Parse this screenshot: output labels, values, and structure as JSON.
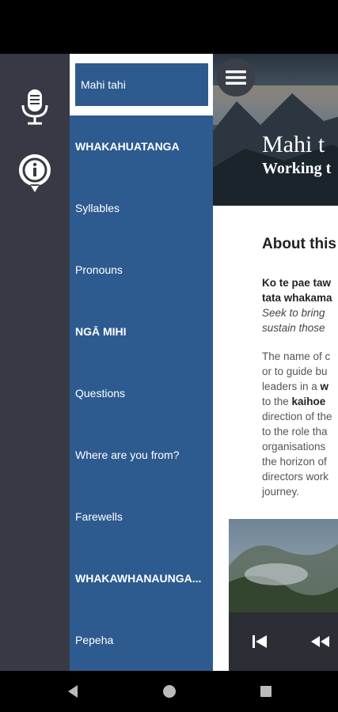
{
  "rail": {
    "icons": [
      "microphone-icon",
      "info-icon"
    ]
  },
  "drawer": {
    "items": [
      {
        "label": "Mahi tahi",
        "type": "item",
        "active": true
      },
      {
        "label": "WHAKAHUATANGA",
        "type": "section"
      },
      {
        "label": "Syllables",
        "type": "item"
      },
      {
        "label": "Pronouns",
        "type": "item"
      },
      {
        "label": "NGĀ MIHI",
        "type": "section"
      },
      {
        "label": "Questions",
        "type": "item"
      },
      {
        "label": "Where are you from?",
        "type": "item"
      },
      {
        "label": "Farewells",
        "type": "item"
      },
      {
        "label": "WHAKAWHANAUNGA...",
        "type": "section"
      },
      {
        "label": "Pepeha",
        "type": "item"
      }
    ]
  },
  "hero": {
    "title": "Mahi t",
    "subtitle": "Working t"
  },
  "about": {
    "heading": "About this",
    "bold_lines": [
      "Ko te pae taw",
      "tata whakama"
    ],
    "italic_lines": [
      "Seek to bring",
      "sustain those"
    ],
    "body_lines": [
      {
        "segments": [
          {
            "t": "The name of c"
          }
        ]
      },
      {
        "segments": [
          {
            "t": "or to guide bu"
          }
        ]
      },
      {
        "segments": [
          {
            "t": "leaders in a "
          },
          {
            "t": "w",
            "b": true
          }
        ]
      },
      {
        "segments": [
          {
            "t": "to the "
          },
          {
            "t": "kaihoe",
            "b": true
          }
        ]
      },
      {
        "segments": [
          {
            "t": "direction of the"
          }
        ]
      },
      {
        "segments": [
          {
            "t": "to the role tha"
          }
        ]
      },
      {
        "segments": [
          {
            "t": "organisations"
          }
        ]
      },
      {
        "segments": [
          {
            "t": "the horizon of"
          }
        ]
      },
      {
        "segments": [
          {
            "t": "directors work"
          }
        ]
      },
      {
        "segments": [
          {
            "t": "journey."
          }
        ]
      }
    ]
  },
  "player": {
    "buttons": [
      "skip-previous-icon",
      "rewind-icon"
    ]
  },
  "navbar": {
    "buttons": [
      "back-icon",
      "home-icon",
      "recents-icon"
    ]
  },
  "colors": {
    "rail": "#373a44",
    "drawer": "#2e5b8f",
    "menu_button": "#3b3f47",
    "player": "#2b2e35"
  }
}
